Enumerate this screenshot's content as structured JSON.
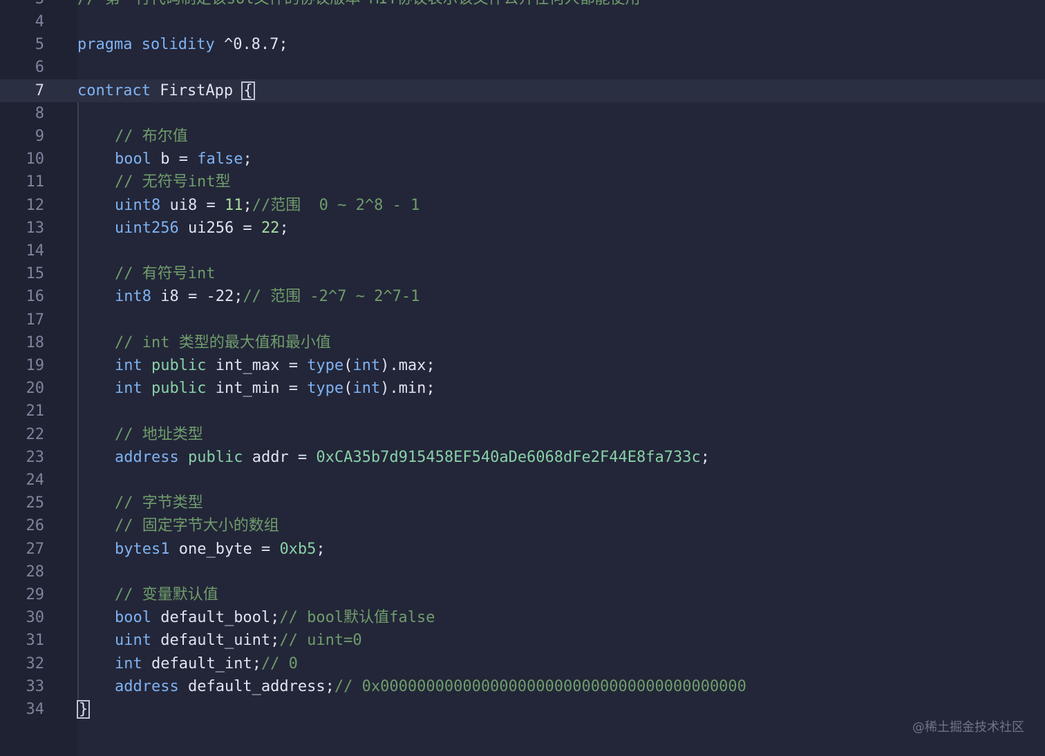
{
  "editor": {
    "language": "solidity",
    "active_line": 7,
    "top_partial_line": {
      "number": "3",
      "text": "// 第一行代码制定该sol文件的协议版本 MIT协议表示该文件公开任何人都能使用"
    },
    "lines": [
      {
        "n": "4",
        "segs": []
      },
      {
        "n": "5",
        "segs": [
          [
            "kw",
            "pragma"
          ],
          [
            "id",
            " "
          ],
          [
            "kw",
            "solidity"
          ],
          [
            "id",
            " ^0.8.7;"
          ]
        ]
      },
      {
        "n": "6",
        "segs": []
      },
      {
        "n": "7",
        "segs": [
          [
            "kw",
            "contract"
          ],
          [
            "id",
            " FirstApp "
          ],
          [
            "brace",
            "{"
          ]
        ]
      },
      {
        "n": "8",
        "segs": []
      },
      {
        "n": "9",
        "indent": true,
        "segs": [
          [
            "com",
            "// 布尔值"
          ]
        ]
      },
      {
        "n": "10",
        "indent": true,
        "segs": [
          [
            "type",
            "bool"
          ],
          [
            "id",
            " b = "
          ],
          [
            "kw",
            "false"
          ],
          [
            "id",
            ";"
          ]
        ]
      },
      {
        "n": "11",
        "indent": true,
        "segs": [
          [
            "com",
            "// 无符号int型"
          ]
        ]
      },
      {
        "n": "12",
        "indent": true,
        "segs": [
          [
            "type",
            "uint8"
          ],
          [
            "id",
            " ui8 = "
          ],
          [
            "num",
            "11"
          ],
          [
            "id",
            ";"
          ],
          [
            "com",
            "//范围  0 ~ 2^8 - 1"
          ]
        ]
      },
      {
        "n": "13",
        "indent": true,
        "segs": [
          [
            "type",
            "uint256"
          ],
          [
            "id",
            " ui256 = "
          ],
          [
            "num",
            "22"
          ],
          [
            "id",
            ";"
          ]
        ]
      },
      {
        "n": "14",
        "segs": []
      },
      {
        "n": "15",
        "indent": true,
        "segs": [
          [
            "com",
            "// 有符号int"
          ]
        ]
      },
      {
        "n": "16",
        "indent": true,
        "segs": [
          [
            "type",
            "int8"
          ],
          [
            "id",
            " i8 = -22;"
          ],
          [
            "com",
            "// 范围 -2^7 ~ 2^7-1"
          ]
        ]
      },
      {
        "n": "17",
        "segs": []
      },
      {
        "n": "18",
        "indent": true,
        "segs": [
          [
            "com",
            "// int 类型的最大值和最小值"
          ]
        ]
      },
      {
        "n": "19",
        "indent": true,
        "segs": [
          [
            "type",
            "int"
          ],
          [
            "id",
            " "
          ],
          [
            "vis",
            "public"
          ],
          [
            "id",
            " int_max = "
          ],
          [
            "kw",
            "type"
          ],
          [
            "id",
            "("
          ],
          [
            "type",
            "int"
          ],
          [
            "id",
            ").max;"
          ]
        ]
      },
      {
        "n": "20",
        "indent": true,
        "segs": [
          [
            "type",
            "int"
          ],
          [
            "id",
            " "
          ],
          [
            "vis",
            "public"
          ],
          [
            "id",
            " int_min = "
          ],
          [
            "kw",
            "type"
          ],
          [
            "id",
            "("
          ],
          [
            "type",
            "int"
          ],
          [
            "id",
            ").min;"
          ]
        ]
      },
      {
        "n": "21",
        "segs": []
      },
      {
        "n": "22",
        "indent": true,
        "segs": [
          [
            "com",
            "// 地址类型"
          ]
        ]
      },
      {
        "n": "23",
        "indent": true,
        "segs": [
          [
            "type",
            "address"
          ],
          [
            "id",
            " "
          ],
          [
            "vis",
            "public"
          ],
          [
            "id",
            " addr = "
          ],
          [
            "hex",
            "0xCA35b7d915458EF540aDe6068dFe2F44E8fa733c"
          ],
          [
            "id",
            ";"
          ]
        ]
      },
      {
        "n": "24",
        "segs": []
      },
      {
        "n": "25",
        "indent": true,
        "segs": [
          [
            "com",
            "// 字节类型"
          ]
        ]
      },
      {
        "n": "26",
        "indent": true,
        "segs": [
          [
            "com",
            "// 固定字节大小的数组"
          ]
        ]
      },
      {
        "n": "27",
        "indent": true,
        "segs": [
          [
            "type",
            "bytes1"
          ],
          [
            "id",
            " one_byte = "
          ],
          [
            "hex",
            "0xb5"
          ],
          [
            "id",
            ";"
          ]
        ]
      },
      {
        "n": "28",
        "segs": []
      },
      {
        "n": "29",
        "indent": true,
        "segs": [
          [
            "com",
            "// 变量默认值"
          ]
        ]
      },
      {
        "n": "30",
        "indent": true,
        "segs": [
          [
            "type",
            "bool"
          ],
          [
            "id",
            " default_bool;"
          ],
          [
            "com",
            "// bool默认值false"
          ]
        ]
      },
      {
        "n": "31",
        "indent": true,
        "segs": [
          [
            "type",
            "uint"
          ],
          [
            "id",
            " default_uint;"
          ],
          [
            "com",
            "// uint=0"
          ]
        ]
      },
      {
        "n": "32",
        "indent": true,
        "segs": [
          [
            "type",
            "int"
          ],
          [
            "id",
            " default_int;"
          ],
          [
            "com",
            "// 0"
          ]
        ]
      },
      {
        "n": "33",
        "indent": true,
        "segs": [
          [
            "type",
            "address"
          ],
          [
            "id",
            " default_address;"
          ],
          [
            "com",
            "// 0x0000000000000000000000000000000000000000"
          ]
        ]
      },
      {
        "n": "34",
        "segs": [
          [
            "brace",
            "}"
          ]
        ]
      }
    ]
  },
  "watermark": "@稀土掘金技术社区",
  "colors": {
    "background": "#232638",
    "gutter": "#1f2233",
    "keyword": "#7fb2f2",
    "visibility": "#88d1a8",
    "number": "#a8dda0",
    "comment": "#6f9d6c",
    "identifier": "#e0e3f0",
    "line_number": "#7f849c"
  }
}
